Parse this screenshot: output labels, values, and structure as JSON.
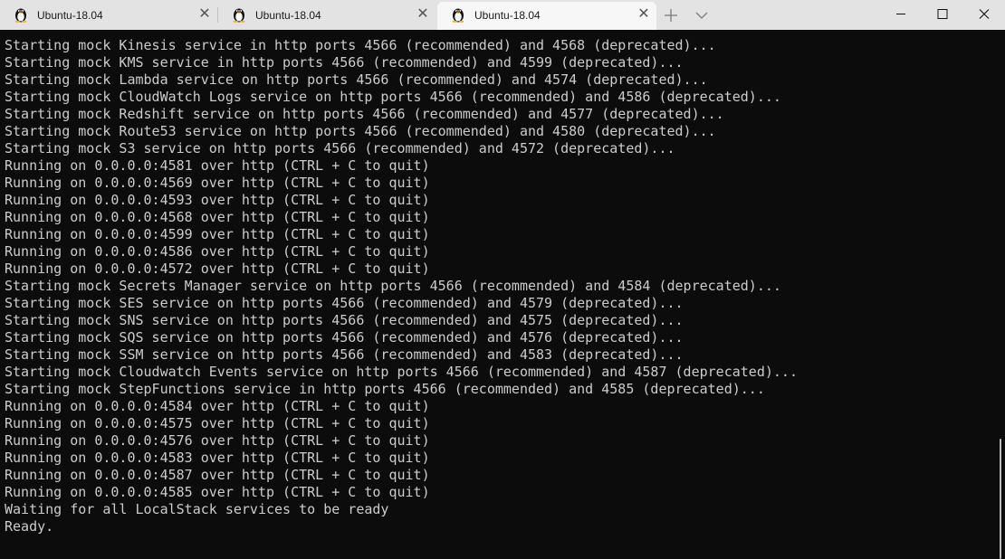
{
  "tabs": [
    {
      "title": "Ubuntu-18.04",
      "icon": "tux-icon",
      "active": false
    },
    {
      "title": "Ubuntu-18.04",
      "icon": "tux-icon",
      "active": false
    },
    {
      "title": "Ubuntu-18.04",
      "icon": "tux-icon",
      "active": true
    }
  ],
  "tabbar": {
    "new_tab_icon": "plus-icon",
    "dropdown_icon": "chevron-down-icon"
  },
  "window_controls": {
    "minimize_icon": "minimize-icon",
    "maximize_icon": "maximize-icon",
    "close_icon": "close-icon"
  },
  "terminal": {
    "lines": [
      "Starting mock Kinesis service in http ports 4566 (recommended) and 4568 (deprecated)...",
      "Starting mock KMS service in http ports 4566 (recommended) and 4599 (deprecated)...",
      "Starting mock Lambda service on http ports 4566 (recommended) and 4574 (deprecated)...",
      "Starting mock CloudWatch Logs service on http ports 4566 (recommended) and 4586 (deprecated)...",
      "Starting mock Redshift service on http ports 4566 (recommended) and 4577 (deprecated)...",
      "Starting mock Route53 service on http ports 4566 (recommended) and 4580 (deprecated)...",
      "Starting mock S3 service on http ports 4566 (recommended) and 4572 (deprecated)...",
      "Running on 0.0.0.0:4581 over http (CTRL + C to quit)",
      "Running on 0.0.0.0:4569 over http (CTRL + C to quit)",
      "Running on 0.0.0.0:4593 over http (CTRL + C to quit)",
      "Running on 0.0.0.0:4568 over http (CTRL + C to quit)",
      "Running on 0.0.0.0:4599 over http (CTRL + C to quit)",
      "Running on 0.0.0.0:4586 over http (CTRL + C to quit)",
      "Running on 0.0.0.0:4572 over http (CTRL + C to quit)",
      "Starting mock Secrets Manager service on http ports 4566 (recommended) and 4584 (deprecated)...",
      "Starting mock SES service on http ports 4566 (recommended) and 4579 (deprecated)...",
      "Starting mock SNS service on http ports 4566 (recommended) and 4575 (deprecated)...",
      "Starting mock SQS service on http ports 4566 (recommended) and 4576 (deprecated)...",
      "Starting mock SSM service on http ports 4566 (recommended) and 4583 (deprecated)...",
      "Starting mock Cloudwatch Events service on http ports 4566 (recommended) and 4587 (deprecated)...",
      "Starting mock StepFunctions service in http ports 4566 (recommended) and 4585 (deprecated)...",
      "Running on 0.0.0.0:4584 over http (CTRL + C to quit)",
      "Running on 0.0.0.0:4575 over http (CTRL + C to quit)",
      "Running on 0.0.0.0:4576 over http (CTRL + C to quit)",
      "Running on 0.0.0.0:4583 over http (CTRL + C to quit)",
      "Running on 0.0.0.0:4587 over http (CTRL + C to quit)",
      "Running on 0.0.0.0:4585 over http (CTRL + C to quit)",
      "Waiting for all LocalStack services to be ready",
      "Ready."
    ]
  },
  "colors": {
    "terminal_background": "#0c0c0c",
    "terminal_foreground": "#cccccc",
    "tabbar_background": "#e3e3e3",
    "active_tab_background": "#f7f7f7"
  }
}
